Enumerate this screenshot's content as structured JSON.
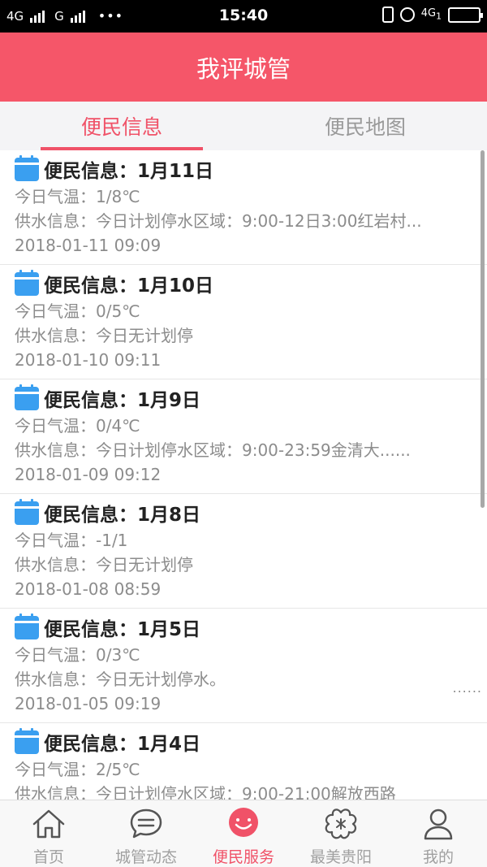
{
  "status_bar": {
    "left_text_1": "4G",
    "left_text_2": "G",
    "left_dots": "•••",
    "time": "15:40",
    "network": "4G",
    "network_sub": "1"
  },
  "header": {
    "title": "我评城管"
  },
  "tabs": [
    {
      "label": "便民信息",
      "active": true
    },
    {
      "label": "便民地图",
      "active": false
    }
  ],
  "items": [
    {
      "title": "便民信息：1月11日",
      "temp": "今日气温：1/8℃",
      "water": "供水信息：今日计划停水区域：9:00-12日3:00红岩村...",
      "date": "2018-01-11 09:09",
      "more": ""
    },
    {
      "title": "便民信息：1月10日",
      "temp": "今日气温：0/5℃",
      "water": "供水信息：今日无计划停",
      "date": "2018-01-10 09:11",
      "more": ""
    },
    {
      "title": "便民信息：1月9日",
      "temp": "今日气温：0/4℃",
      "water": "供水信息：今日计划停水区域：9:00-23:59金清大......",
      "date": "2018-01-09 09:12",
      "more": ""
    },
    {
      "title": "便民信息：1月8日",
      "temp": "今日气温：-1/1",
      "water": "供水信息：今日无计划停",
      "date": "2018-01-08 08:59",
      "more": ""
    },
    {
      "title": "便民信息：1月5日",
      "temp": "今日气温：0/3℃",
      "water": "供水信息：今日无计划停水。",
      "date": "2018-01-05 09:19",
      "more": "......"
    },
    {
      "title": "便民信息：1月4日",
      "temp": "今日气温：2/5℃",
      "water": "供水信息：今日计划停水区域：9:00-21:00解放西路",
      "date": "",
      "more": ""
    }
  ],
  "bottom_nav": [
    {
      "label": "首页",
      "icon": "home-icon",
      "active": false
    },
    {
      "label": "城管动态",
      "icon": "chat-bubble-icon",
      "active": false
    },
    {
      "label": "便民服务",
      "icon": "smiley-icon",
      "active": true
    },
    {
      "label": "最美贵阳",
      "icon": "flower-icon",
      "active": false
    },
    {
      "label": "我的",
      "icon": "person-icon",
      "active": false
    }
  ],
  "colors": {
    "brand": "#f55669",
    "accent": "#f05268",
    "calendar": "#3a9ff0",
    "muted_text": "#8c8c8c"
  }
}
